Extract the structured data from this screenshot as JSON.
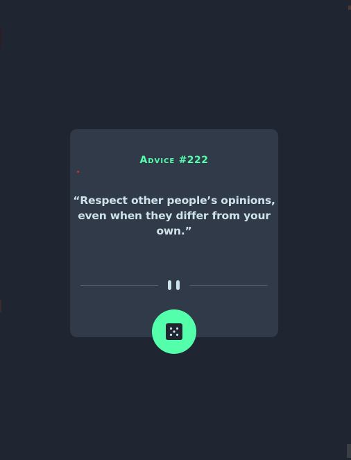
{
  "advice": {
    "label": "Advice",
    "number": "#222",
    "quote": "“Respect other people’s opinions, even when they differ from your own.”"
  },
  "button": {
    "icon": "dice-icon"
  },
  "colors": {
    "background": "#1f2632",
    "card": "#313a48",
    "accent": "#53ffaa",
    "text": "#cee3e9",
    "divider": "#4f5d74"
  }
}
